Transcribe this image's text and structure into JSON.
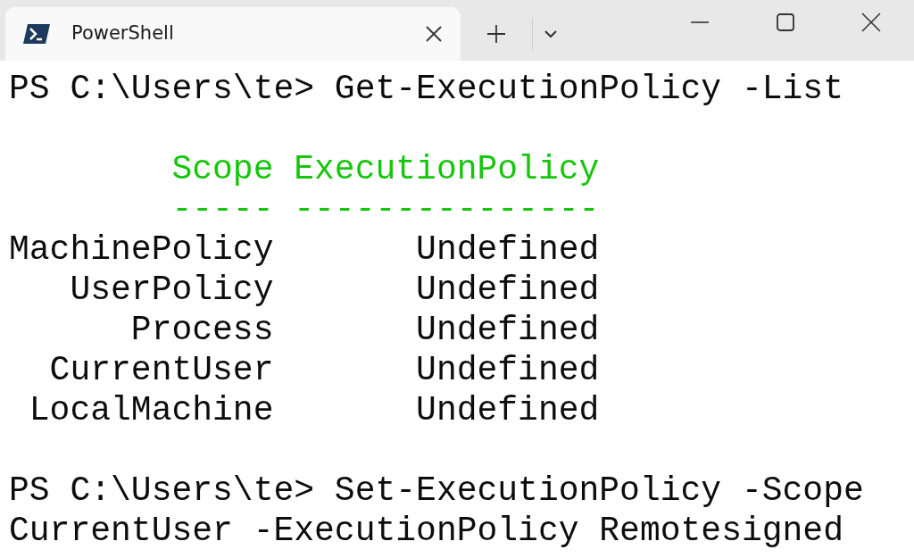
{
  "tab": {
    "title": "PowerShell",
    "selected": true
  },
  "lines": [
    {
      "kind": "output",
      "text": "PS C:\\Users\\te> Get-ExecutionPolicy -List"
    },
    {
      "kind": "blank"
    },
    {
      "kind": "header",
      "text": "        Scope ExecutionPolicy"
    },
    {
      "kind": "header",
      "text": "        ----- ---------------"
    },
    {
      "kind": "output",
      "text": "MachinePolicy       Undefined"
    },
    {
      "kind": "output",
      "text": "   UserPolicy       Undefined"
    },
    {
      "kind": "output",
      "text": "      Process       Undefined"
    },
    {
      "kind": "output",
      "text": "  CurrentUser       Undefined"
    },
    {
      "kind": "output",
      "text": " LocalMachine       Undefined"
    },
    {
      "kind": "blank"
    },
    {
      "kind": "output",
      "text": "PS C:\\Users\\te> Set-ExecutionPolicy -Scope"
    },
    {
      "kind": "output",
      "text": "CurrentUser -ExecutionPolicy Remotesigned"
    }
  ]
}
